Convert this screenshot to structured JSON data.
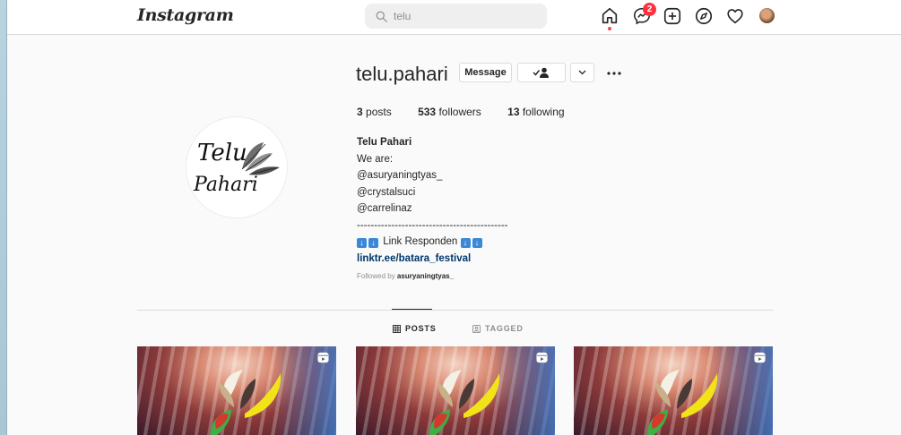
{
  "topbar": {
    "logo": "Instagram",
    "search": {
      "value": "telu",
      "icon": "search-icon"
    },
    "icons": [
      "home-icon",
      "messenger-icon",
      "new-post-icon",
      "explore-icon",
      "activity-heart-icon",
      "profile-avatar"
    ],
    "messenger_badge": "2",
    "colors": {
      "badge": "#ff3040",
      "home_dot": "#ed4956"
    }
  },
  "profile": {
    "username": "telu.pahari",
    "message_label": "Message",
    "picture_text_line1": "Telu",
    "picture_text_line2": "Pahari",
    "stats": {
      "posts_count": "3",
      "posts_label": "posts",
      "followers_count": "533",
      "followers_label": "followers",
      "following_count": "13",
      "following_label": "following"
    },
    "bio": {
      "name": "Telu Pahari",
      "line1": "We are:",
      "line2": "@asuryaningtyas_",
      "line3": "@crystalsuci",
      "line4": "@carrelinaz",
      "divider": "--------------------------------------------",
      "link_label": "Link Responden",
      "link_url": "linktr.ee/batara_festival"
    },
    "followed_by_prefix": "Followed by ",
    "followed_by_user": "asuryaningtyas_"
  },
  "tabs": [
    {
      "label": "POSTS",
      "icon": "grid-icon",
      "active": true
    },
    {
      "label": "TAGGED",
      "icon": "tag-icon",
      "active": false
    }
  ],
  "posts": [
    {
      "type": "reel",
      "icon": "reels-icon"
    },
    {
      "type": "reel",
      "icon": "reels-icon"
    },
    {
      "type": "reel",
      "icon": "reels-icon"
    }
  ]
}
